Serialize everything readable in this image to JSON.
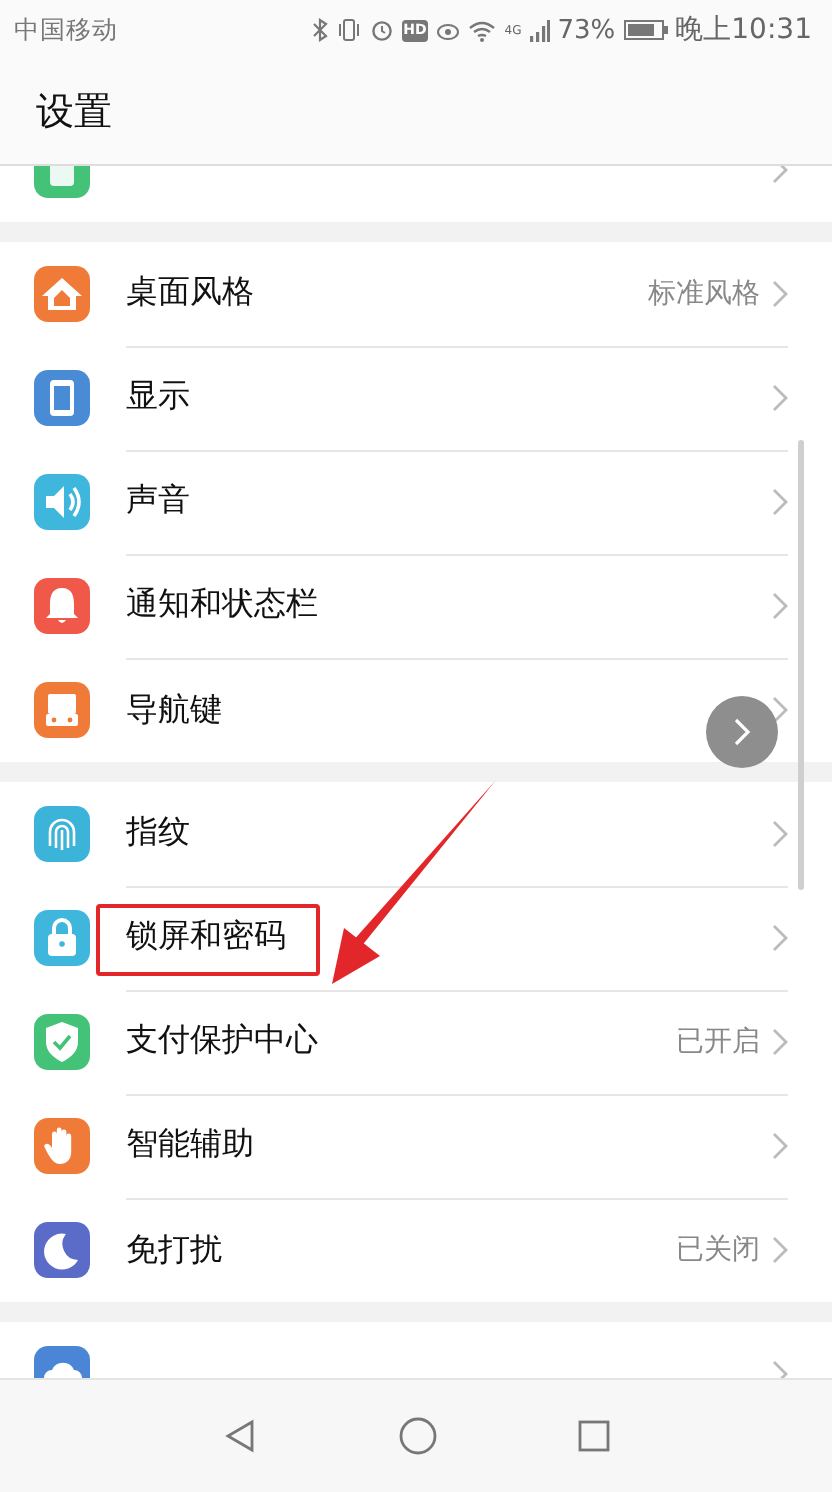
{
  "status_bar": {
    "carrier": "中国移动",
    "hd": "HD",
    "network": "4G",
    "battery": "73%",
    "time": "晚上10:31"
  },
  "title": "设置",
  "sections": [
    {
      "items": [
        {
          "label": "桌面风格",
          "value": "标准风格"
        },
        {
          "label": "显示"
        },
        {
          "label": "声音"
        },
        {
          "label": "通知和状态栏"
        },
        {
          "label": "导航键"
        }
      ]
    },
    {
      "items": [
        {
          "label": "指纹"
        },
        {
          "label": "锁屏和密码"
        },
        {
          "label": "支付保护中心",
          "value": "已开启"
        },
        {
          "label": "智能辅助"
        },
        {
          "label": "免打扰",
          "value": "已关闭"
        }
      ]
    }
  ]
}
